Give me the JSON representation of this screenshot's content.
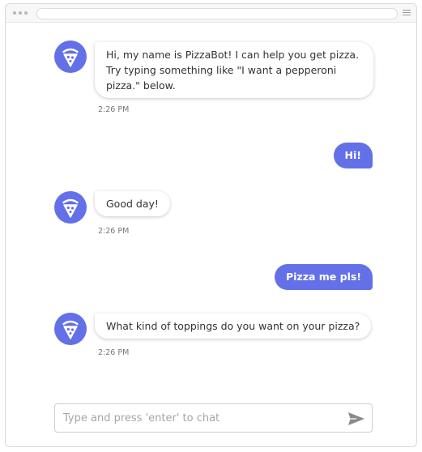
{
  "input": {
    "placeholder": "Type and press 'enter' to chat"
  },
  "messages": [
    {
      "from": "bot",
      "text": "Hi, my name is PizzaBot! I can help you get pizza. Try typing something like \"I want a pepperoni pizza.\" below.",
      "time": "2:26 PM"
    },
    {
      "from": "user",
      "text": "Hi!"
    },
    {
      "from": "bot",
      "text": "Good day!",
      "time": "2:26 PM"
    },
    {
      "from": "user",
      "text": "Pizza me pls!"
    },
    {
      "from": "bot",
      "text": "What kind of toppings do you want on your pizza?",
      "time": "2:26 PM"
    }
  ],
  "colors": {
    "accent": "#6370e8",
    "bubble_text": "#333333"
  },
  "icons": {
    "avatar": "pizza-slice-icon",
    "send": "send-icon",
    "menu": "hamburger-menu-icon"
  }
}
